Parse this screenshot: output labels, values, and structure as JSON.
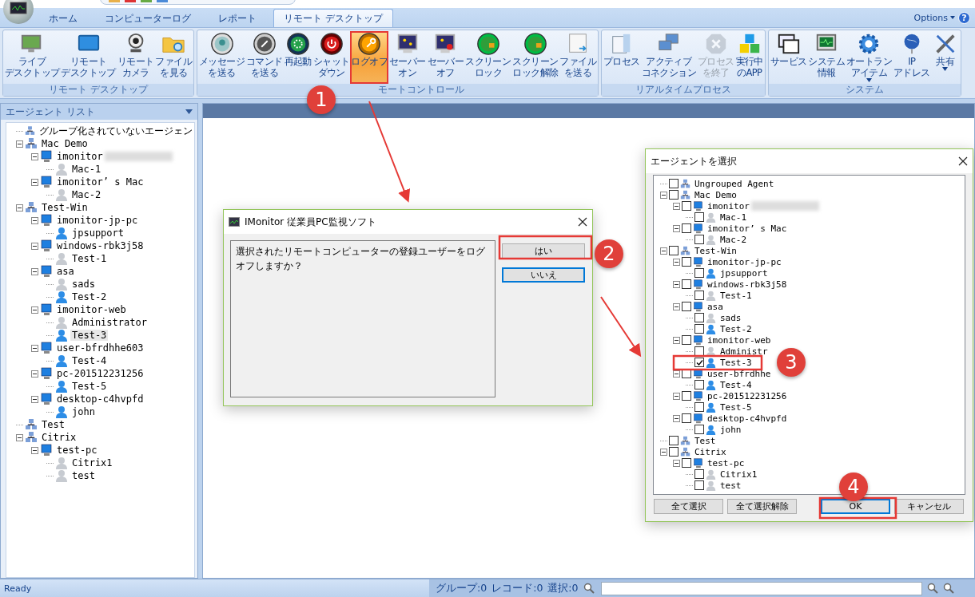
{
  "tabs": [
    {
      "label": "ホーム",
      "selected": false
    },
    {
      "label": "コンピューターログ",
      "selected": false
    },
    {
      "label": "レポート",
      "selected": false
    },
    {
      "label": "リモート デスクトップ",
      "selected": true
    }
  ],
  "options": {
    "label": "Options",
    "help": "?"
  },
  "ribbon": [
    {
      "label": "リモート デスクトップ",
      "buttons": [
        {
          "lines": [
            "ライブ",
            "デスクトップ"
          ],
          "active": false,
          "disabled": false
        },
        {
          "lines": [
            "リモート",
            "デスクトップ"
          ],
          "active": false,
          "disabled": false
        },
        {
          "lines": [
            "リモート",
            "カメラ"
          ],
          "active": false,
          "disabled": false
        },
        {
          "lines": [
            "ファイル",
            "を見る"
          ],
          "active": false,
          "disabled": false
        }
      ]
    },
    {
      "label": "モートコントロール",
      "buttons": [
        {
          "lines": [
            "メッセージ",
            "を送る"
          ],
          "active": false,
          "disabled": false
        },
        {
          "lines": [
            "コマンド",
            "を送る"
          ],
          "active": false,
          "disabled": false
        },
        {
          "lines": [
            "再起動"
          ],
          "active": false,
          "disabled": false
        },
        {
          "lines": [
            "シャット",
            "ダウン"
          ],
          "active": false,
          "disabled": false
        },
        {
          "lines": [
            "ログオフ"
          ],
          "active": true,
          "disabled": false
        },
        {
          "lines": [
            "セーバー",
            "オン"
          ],
          "active": false,
          "disabled": false
        },
        {
          "lines": [
            "セーバー",
            "オフ"
          ],
          "active": false,
          "disabled": false
        },
        {
          "lines": [
            "スクリーン",
            "ロック"
          ],
          "active": false,
          "disabled": false
        },
        {
          "lines": [
            "スクリーン",
            "ロック解除"
          ],
          "active": false,
          "disabled": false
        },
        {
          "lines": [
            "ファイル",
            "を送る"
          ],
          "active": false,
          "disabled": false
        }
      ]
    },
    {
      "label": "リアルタイムプロセス",
      "buttons": [
        {
          "lines": [
            "プロセス"
          ],
          "active": false,
          "disabled": false
        },
        {
          "lines": [
            "アクティブ",
            "コネクション"
          ],
          "active": false,
          "disabled": false
        },
        {
          "lines": [
            "プロセス",
            "を終了"
          ],
          "active": false,
          "disabled": true
        },
        {
          "lines": [
            "実行中",
            "のAPP"
          ],
          "active": false,
          "disabled": false
        }
      ]
    },
    {
      "label": "システム",
      "buttons": [
        {
          "lines": [
            "サービス"
          ],
          "active": false,
          "disabled": false
        },
        {
          "lines": [
            "システム",
            "情報"
          ],
          "active": false,
          "disabled": false
        },
        {
          "lines": [
            "オートラン",
            "アイテム"
          ],
          "active": false,
          "disabled": false,
          "dropdown": true
        },
        {
          "lines": [
            "IP",
            "アドレス"
          ],
          "active": false,
          "disabled": false
        },
        {
          "lines": [
            "共有"
          ],
          "active": false,
          "disabled": false,
          "dropdown": true
        }
      ]
    }
  ],
  "agent_list": {
    "title": "エージェント リスト",
    "tree": [
      {
        "label": "グループ化されていないエージェン",
        "kind": "group",
        "selected": false
      },
      {
        "label": "Mac Demo",
        "kind": "group",
        "selected": false,
        "children": [
          {
            "label": "imonitor",
            "kind": "computer",
            "redacted": true,
            "selected": false,
            "children": [
              {
                "label": "Mac-1",
                "kind": "user",
                "online": false,
                "selected": false
              }
            ]
          },
          {
            "label": "imonitor’ s Mac",
            "kind": "computer",
            "selected": false,
            "children": [
              {
                "label": "Mac-2",
                "kind": "user",
                "online": false,
                "selected": false
              }
            ]
          }
        ]
      },
      {
        "label": "Test-Win",
        "kind": "group",
        "selected": false,
        "children": [
          {
            "label": "imonitor-jp-pc",
            "kind": "computer",
            "selected": false,
            "children": [
              {
                "label": "jpsupport",
                "kind": "user",
                "online": true,
                "selected": false
              }
            ]
          },
          {
            "label": "windows-rbk3j58",
            "kind": "computer",
            "selected": false,
            "children": [
              {
                "label": "Test-1",
                "kind": "user",
                "online": false,
                "selected": false
              }
            ]
          },
          {
            "label": "asa",
            "kind": "computer",
            "selected": false,
            "children": [
              {
                "label": "sads",
                "kind": "user",
                "online": false,
                "selected": false
              },
              {
                "label": "Test-2",
                "kind": "user",
                "online": true,
                "selected": false
              }
            ]
          },
          {
            "label": "imonitor-web",
            "kind": "computer",
            "selected": false,
            "children": [
              {
                "label": "Administrator",
                "kind": "user",
                "online": false,
                "selected": false
              },
              {
                "label": "Test-3",
                "kind": "user",
                "online": true,
                "selected": true
              }
            ]
          },
          {
            "label": "user-bfrdhhe603",
            "kind": "computer",
            "selected": false,
            "children": [
              {
                "label": "Test-4",
                "kind": "user",
                "online": true,
                "selected": false
              }
            ]
          },
          {
            "label": "pc-201512231256",
            "kind": "computer",
            "selected": false,
            "children": [
              {
                "label": "Test-5",
                "kind": "user",
                "online": true,
                "selected": false
              }
            ]
          },
          {
            "label": "desktop-c4hvpfd",
            "kind": "computer",
            "selected": false,
            "children": [
              {
                "label": "john",
                "kind": "user",
                "online": true,
                "selected": false
              }
            ]
          }
        ]
      },
      {
        "label": "Test",
        "kind": "group",
        "selected": false
      },
      {
        "label": "Citrix",
        "kind": "group",
        "selected": false,
        "children": [
          {
            "label": "test-pc",
            "kind": "computer",
            "selected": false,
            "children": [
              {
                "label": "Citrix1",
                "kind": "user",
                "online": false,
                "selected": false
              },
              {
                "label": "test",
                "kind": "user",
                "online": false,
                "selected": false
              }
            ]
          }
        ]
      }
    ]
  },
  "confirm_dialog": {
    "title": "IMonitor 従業員PC監視ソフト",
    "message": "選択されたリモートコンピューターの登録ユーザーをログオフしますか？",
    "buttons": [
      {
        "label": "はい",
        "focused": false
      },
      {
        "label": "いいえ",
        "focused": true
      }
    ]
  },
  "select_dialog": {
    "title": "エージェントを選択",
    "tree": [
      {
        "label": "Ungrouped Agent",
        "kind": "group",
        "checked": false
      },
      {
        "label": "Mac Demo",
        "kind": "group",
        "checked": false,
        "children": [
          {
            "label": "imonitor",
            "kind": "computer",
            "redacted": true,
            "checked": false,
            "children": [
              {
                "label": "Mac-1",
                "kind": "user",
                "online": false,
                "checked": false
              }
            ]
          },
          {
            "label": "imonitor’ s Mac",
            "kind": "computer",
            "checked": false,
            "children": [
              {
                "label": "Mac-2",
                "kind": "user",
                "online": false,
                "checked": false
              }
            ]
          }
        ]
      },
      {
        "label": "Test-Win",
        "kind": "group",
        "checked": false,
        "children": [
          {
            "label": "imonitor-jp-pc",
            "kind": "computer",
            "checked": false,
            "children": [
              {
                "label": "jpsupport",
                "kind": "user",
                "online": true,
                "checked": false
              }
            ]
          },
          {
            "label": "windows-rbk3j58",
            "kind": "computer",
            "checked": false,
            "children": [
              {
                "label": "Test-1",
                "kind": "user",
                "online": false,
                "checked": false
              }
            ]
          },
          {
            "label": "asa",
            "kind": "computer",
            "checked": false,
            "children": [
              {
                "label": "sads",
                "kind": "user",
                "online": false,
                "checked": false
              },
              {
                "label": "Test-2",
                "kind": "user",
                "online": true,
                "checked": false
              }
            ]
          },
          {
            "label": "imonitor-web",
            "kind": "computer",
            "checked": false,
            "children": [
              {
                "label": "Administr",
                "kind": "user",
                "online": false,
                "checked": false
              },
              {
                "label": "Test-3",
                "kind": "user",
                "online": true,
                "checked": true
              }
            ]
          },
          {
            "label": "user-bfrdhhe",
            "kind": "computer",
            "checked": false,
            "children": [
              {
                "label": "Test-4",
                "kind": "user",
                "online": true,
                "checked": false
              }
            ]
          },
          {
            "label": "pc-201512231256",
            "kind": "computer",
            "checked": false,
            "children": [
              {
                "label": "Test-5",
                "kind": "user",
                "online": true,
                "checked": false
              }
            ]
          },
          {
            "label": "desktop-c4hvpfd",
            "kind": "computer",
            "checked": false,
            "children": [
              {
                "label": "john",
                "kind": "user",
                "online": true,
                "checked": false
              }
            ]
          }
        ]
      },
      {
        "label": "Test",
        "kind": "group",
        "checked": false
      },
      {
        "label": "Citrix",
        "kind": "group",
        "checked": false,
        "children": [
          {
            "label": "test-pc",
            "kind": "computer",
            "checked": false,
            "children": [
              {
                "label": "Citrix1",
                "kind": "user",
                "online": false,
                "checked": false
              },
              {
                "label": "test",
                "kind": "user",
                "online": false,
                "checked": false
              }
            ]
          }
        ]
      }
    ],
    "buttons": [
      {
        "label": "全て選択",
        "focused": false
      },
      {
        "label": "全て選択解除",
        "focused": false
      },
      {
        "label": "OK",
        "focused": true
      },
      {
        "label": "キャンセル",
        "focused": false
      }
    ]
  },
  "status_bar": {
    "status": "Ready",
    "counts": [
      "グループ:0",
      "レコード:0",
      "選択:0"
    ]
  },
  "annotations": [
    {
      "label": "1"
    },
    {
      "label": "2"
    },
    {
      "label": "3"
    },
    {
      "label": "4"
    }
  ]
}
